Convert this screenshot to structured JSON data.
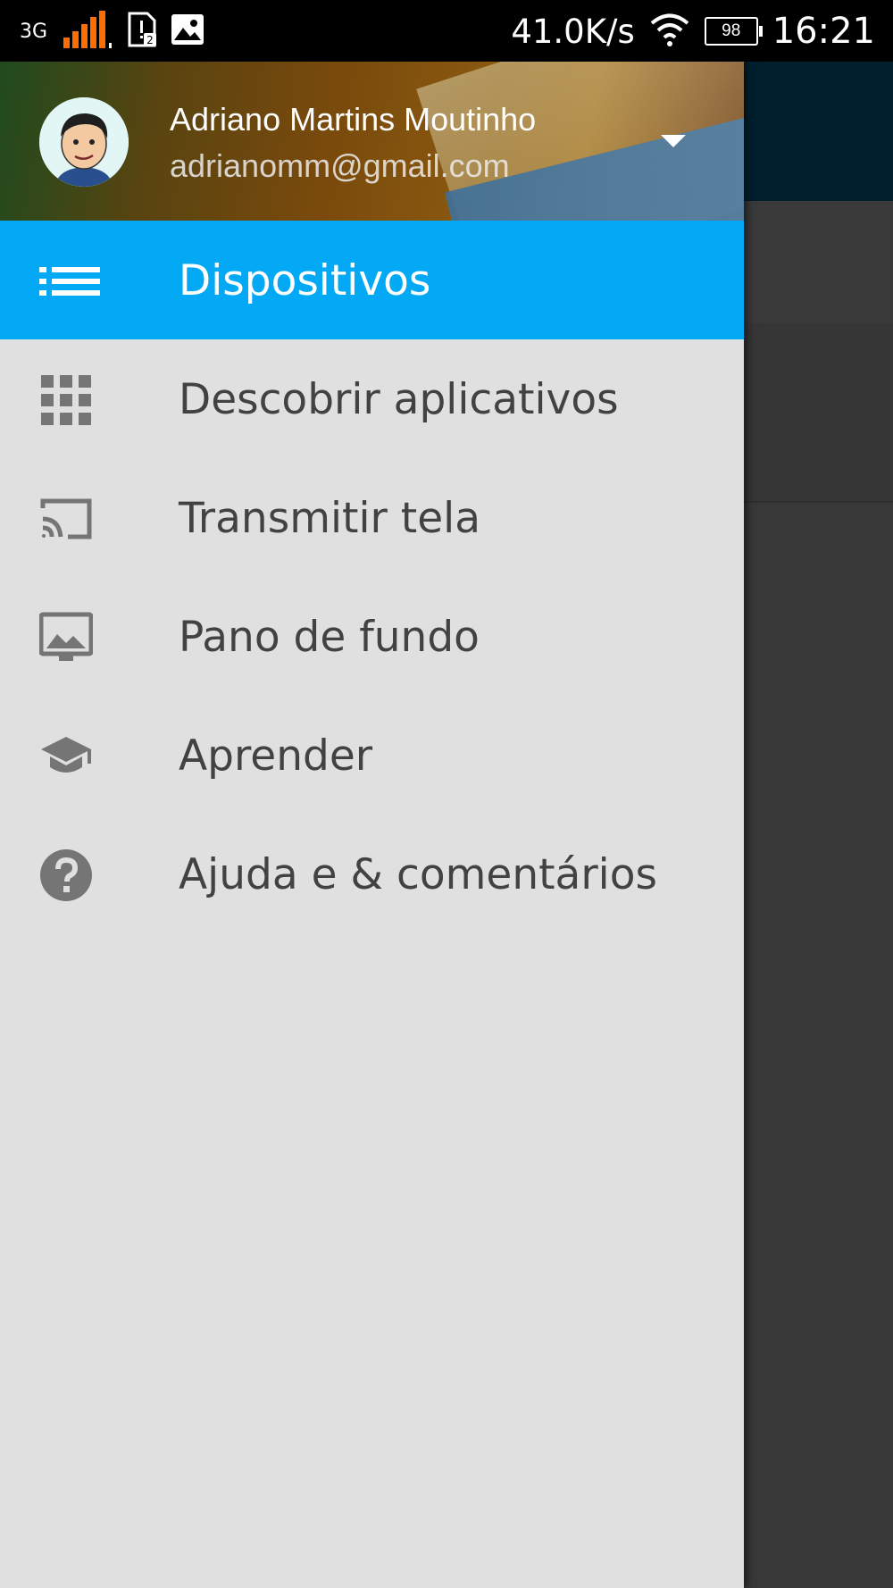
{
  "status_bar": {
    "network": "3G",
    "net_speed": "41.0K/s",
    "battery": "98",
    "time": "16:21",
    "icons": [
      "signal-icon",
      "sim-notification-icon",
      "image-notification-icon",
      "wifi-icon",
      "battery-icon"
    ]
  },
  "drawer": {
    "account": {
      "name": "Adriano Martins Moutinho",
      "email": "adrianomm@gmail.com"
    },
    "items": [
      {
        "label": "Dispositivos",
        "icon": "list-icon",
        "active": true
      },
      {
        "label": "Descobrir aplicativos",
        "icon": "apps-grid-icon",
        "active": false
      },
      {
        "label": "Transmitir tela",
        "icon": "cast-icon",
        "active": false
      },
      {
        "label": "Pano de fundo",
        "icon": "wallpaper-icon",
        "active": false
      },
      {
        "label": "Aprender",
        "icon": "school-icon",
        "active": false
      },
      {
        "label": "Ajuda e & comentários",
        "icon": "help-icon",
        "active": false
      }
    ],
    "colors": {
      "active": "#03a9f4",
      "background": "#e0e0e0",
      "icon": "#757575"
    }
  }
}
